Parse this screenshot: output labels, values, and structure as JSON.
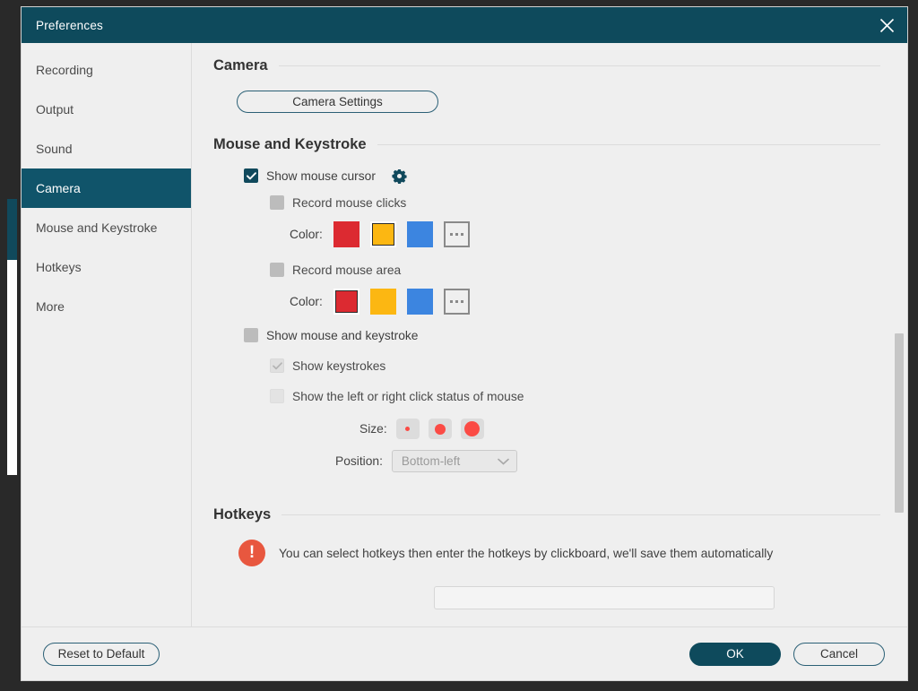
{
  "window": {
    "title": "Preferences",
    "close_icon": "close-icon",
    "accent_teal": "#0e4a5c",
    "active_item_teal": "#10546a",
    "alert_orange": "#e8573f"
  },
  "sidebar": {
    "items": [
      {
        "label": "Recording",
        "active": false
      },
      {
        "label": "Output",
        "active": false
      },
      {
        "label": "Sound",
        "active": false
      },
      {
        "label": "Camera",
        "active": true
      },
      {
        "label": "Mouse and Keystroke",
        "active": false
      },
      {
        "label": "Hotkeys",
        "active": false
      },
      {
        "label": "More",
        "active": false
      }
    ]
  },
  "sections": {
    "camera": {
      "title": "Camera",
      "settings_button": "Camera Settings"
    },
    "mouse_keystroke": {
      "title": "Mouse and Keystroke",
      "show_mouse_cursor": {
        "label": "Show mouse cursor",
        "checked": true,
        "gear_icon": "gear-icon"
      },
      "record_mouse_clicks": {
        "label": "Record mouse clicks",
        "checked": false,
        "color_label": "Color:",
        "colors": [
          {
            "name": "red",
            "hex": "#dc2a31",
            "selected": false
          },
          {
            "name": "yellow",
            "hex": "#fcb712",
            "selected": true
          },
          {
            "name": "blue",
            "hex": "#3c85e0",
            "selected": false
          }
        ],
        "more_colors": "..."
      },
      "record_mouse_area": {
        "label": "Record mouse area",
        "checked": false,
        "color_label": "Color:",
        "colors": [
          {
            "name": "red",
            "hex": "#dc2a31",
            "selected": true
          },
          {
            "name": "yellow",
            "hex": "#fcb712",
            "selected": false
          },
          {
            "name": "blue",
            "hex": "#3c85e0",
            "selected": false
          }
        ],
        "more_colors": "..."
      },
      "show_mouse_and_keystroke": {
        "label": "Show mouse and keystroke",
        "checked": false
      },
      "show_keystrokes": {
        "label": "Show keystrokes",
        "checked": true,
        "disabled": true
      },
      "show_click_status": {
        "label": "Show the left or right click status of mouse",
        "checked": false,
        "disabled": true
      },
      "size": {
        "label": "Size:",
        "options": [
          "small",
          "medium",
          "large"
        ],
        "dot_color": "#fb4b45"
      },
      "position": {
        "label": "Position:",
        "value": "Bottom-left",
        "chevron_icon": "chevron-down-icon",
        "disabled": true
      }
    },
    "hotkeys": {
      "title": "Hotkeys",
      "notice": "You can select hotkeys then enter the hotkeys by clickboard, we'll save them automatically",
      "alert_icon": "alert-icon",
      "field_value": ""
    }
  },
  "footer": {
    "reset": "Reset to Default",
    "ok": "OK",
    "cancel": "Cancel"
  }
}
